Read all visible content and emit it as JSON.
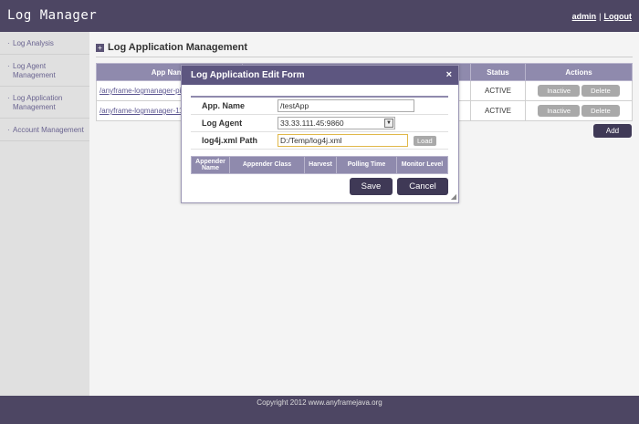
{
  "header": {
    "title": "Log Manager",
    "user": "admin",
    "logout": "Logout"
  },
  "sidebar": {
    "items": [
      {
        "label": "Log Analysis"
      },
      {
        "label": "Log Agent Management"
      },
      {
        "label": "Log Application Management"
      },
      {
        "label": "Account Management"
      }
    ]
  },
  "page": {
    "title": "Log Application Management"
  },
  "grid": {
    "headers": {
      "app_name": "App Name",
      "status": "Status",
      "actions": "Actions"
    },
    "rows": [
      {
        "app_name": "/anyframe-logmanager-pi",
        "status": "ACTIVE",
        "inactive": "Inactive",
        "delete": "Delete"
      },
      {
        "app_name": "/anyframe-logmanager-11",
        "status": "ACTIVE",
        "inactive": "Inactive",
        "delete": "Delete"
      }
    ],
    "add_label": "Add"
  },
  "dialog": {
    "title": "Log Application Edit Form",
    "close": "×",
    "fields": {
      "app_name_label": "App. Name",
      "app_name_value": "/testApp",
      "agent_label": "Log Agent",
      "agent_value": "33.33.111.45:9860",
      "path_label": "log4j.xml Path",
      "path_value": "D:/Temp/log4j.xml",
      "load_label": "Load"
    },
    "appender_headers": [
      "Appender Name",
      "Appender Class",
      "Harvest",
      "Polling Time",
      "Monitor Level"
    ],
    "save_label": "Save",
    "cancel_label": "Cancel"
  },
  "footer": {
    "text": "Copyright 2012 www.anyframejava.org"
  }
}
